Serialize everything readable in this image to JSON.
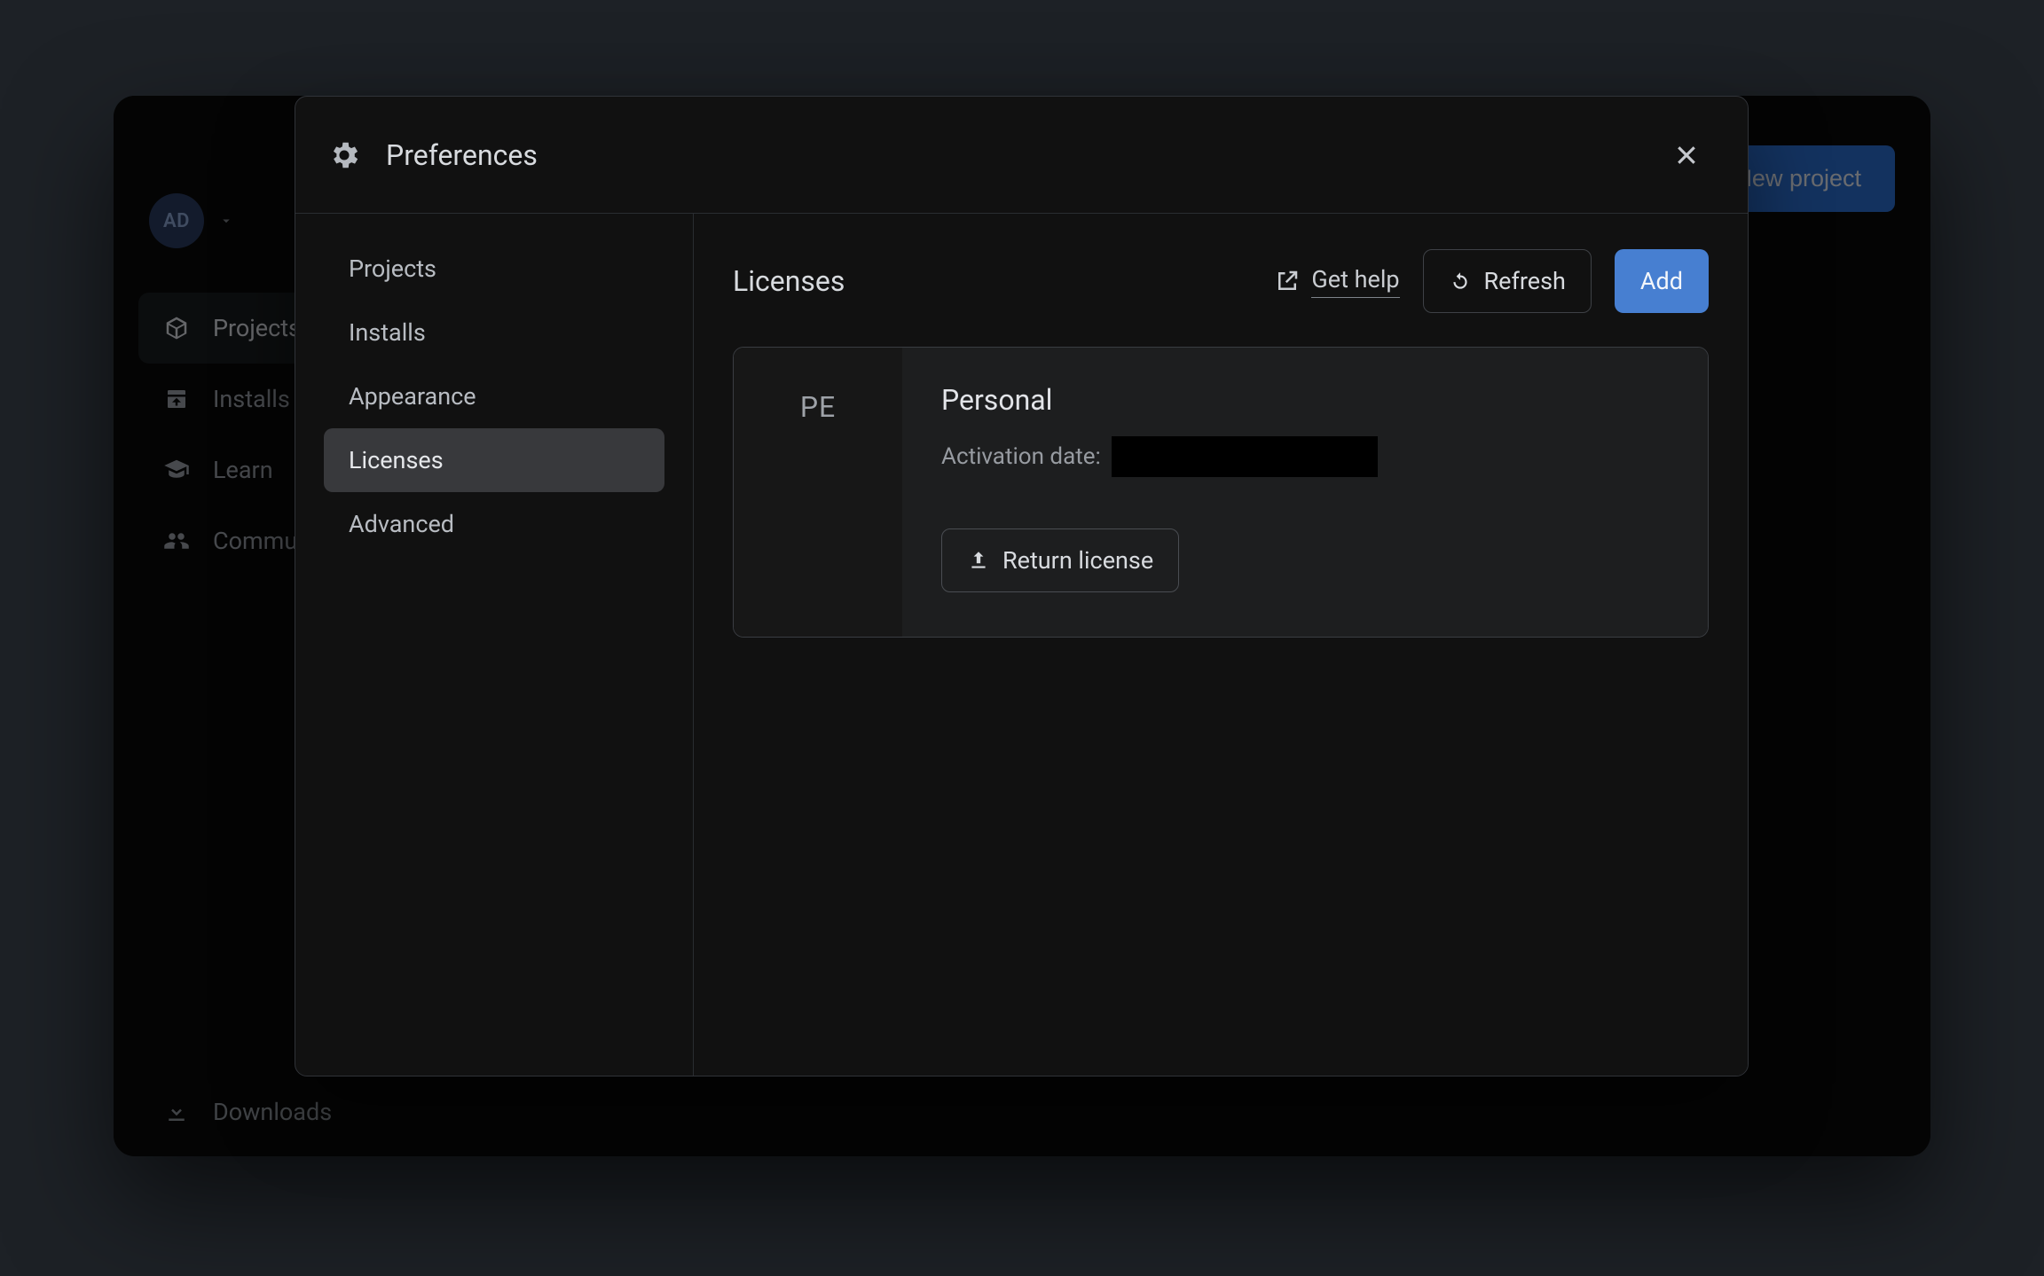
{
  "colors": {
    "accent": "#477fd1",
    "background": "#1d2126",
    "window": "#0a0a0a",
    "modal": "#111111"
  },
  "main_window": {
    "user_initials": "AD",
    "sidebar": {
      "items": [
        {
          "label": "Projects"
        },
        {
          "label": "Installs"
        },
        {
          "label": "Learn"
        },
        {
          "label": "Community"
        }
      ],
      "active_index": 0
    },
    "downloads_label": "Downloads",
    "new_project_label": "New project"
  },
  "modal": {
    "title": "Preferences",
    "sidebar": {
      "items": [
        {
          "label": "Projects"
        },
        {
          "label": "Installs"
        },
        {
          "label": "Appearance"
        },
        {
          "label": "Licenses"
        },
        {
          "label": "Advanced"
        }
      ],
      "active_index": 3
    },
    "content": {
      "section_title": "Licenses",
      "get_help_label": "Get help",
      "refresh_label": "Refresh",
      "add_label": "Add",
      "license": {
        "badge_initials": "PE",
        "name": "Personal",
        "activation_label": "Activation date:",
        "return_label": "Return license"
      }
    }
  }
}
